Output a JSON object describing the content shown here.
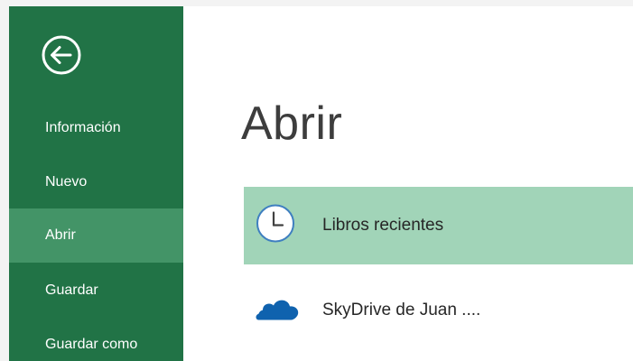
{
  "colors": {
    "sidebar_bg": "#217346",
    "sidebar_active": "#439467",
    "selected_location": "#a1d4b8",
    "onedrive_blue": "#0f62ae"
  },
  "sidebar": {
    "back_icon": "back-arrow-circle-icon",
    "items": [
      {
        "label": "Información",
        "active": false
      },
      {
        "label": "Nuevo",
        "active": false
      },
      {
        "label": "Abrir",
        "active": true
      },
      {
        "label": "Guardar",
        "active": false
      },
      {
        "label": "Guardar como",
        "active": false
      }
    ]
  },
  "main": {
    "title": "Abrir",
    "locations": [
      {
        "label": "Libros recientes",
        "icon": "clock-icon",
        "selected": true
      },
      {
        "label": "SkyDrive de Juan ....",
        "icon": "skydrive-cloud-icon",
        "selected": false
      }
    ]
  }
}
